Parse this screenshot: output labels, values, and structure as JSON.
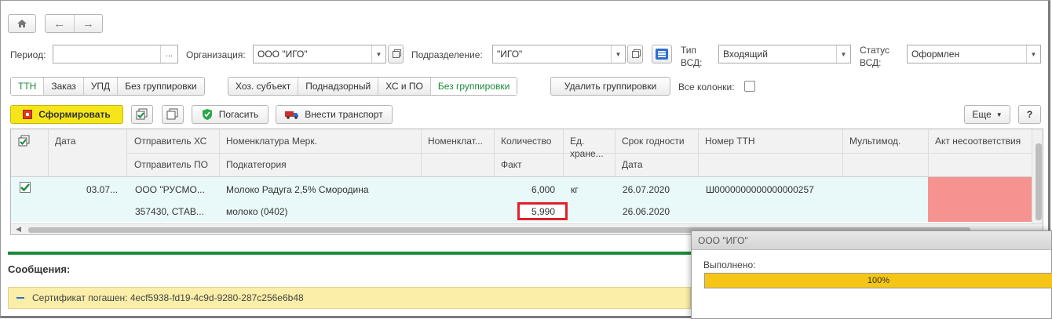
{
  "nav": {
    "home_icon": "home-icon",
    "back_icon": "arrow-left-icon",
    "forward_icon": "arrow-right-icon"
  },
  "filters": {
    "period_label": "Период:",
    "period_value": "",
    "period_btn": "...",
    "org_label": "Организация:",
    "org_value": "ООО \"ИГО\"",
    "division_label": "Подразделение:",
    "division_value": "\"ИГО\"",
    "vsd_type_label_1": "Тип",
    "vsd_type_label_2": "ВСД:",
    "vsd_type_value": "Входящий",
    "vsd_status_label_1": "Статус",
    "vsd_status_label_2": "ВСД:",
    "vsd_status_value": "Оформлен"
  },
  "grouping": {
    "group1": [
      "ТТН",
      "Заказ",
      "УПД",
      "Без группировки"
    ],
    "group1_active": 0,
    "group2": [
      "Хоз. субъект",
      "Поднадзорный",
      "ХС и ПО",
      "Без группировки"
    ],
    "group2_active": 3,
    "remove_grouping": "Удалить группировки",
    "all_columns_label": "Все колонки:"
  },
  "toolbar": {
    "form_button": "Сформировать",
    "repay_button": "Погасить",
    "transport_button": "Внести транспорт",
    "more_button": "Еще",
    "help_button": "?"
  },
  "table": {
    "headers_top": [
      "Дата",
      "Отправитель ХС",
      "Номенклатура Мерк.",
      "Номенклат...",
      "Количество",
      "Ед.",
      "Срок годности",
      "Номер ТТН",
      "Мультимод.",
      "Акт несоответствия"
    ],
    "headers_bottom": [
      "Отправитель ПО",
      "Подкатегория",
      "Факт",
      "хране...",
      "Дата"
    ],
    "row": {
      "checked": true,
      "date": "03.07...",
      "sender_hs": "ООО \"РУСМО...",
      "nomenclature": "Молоко Радуга 2,5% Смородина",
      "quantity": "6,000",
      "unit": "кг",
      "expiry": "26.07.2020",
      "ttn_number": "Ш0000000000000000257",
      "sender_po": "357430, СТАВ...",
      "subcategory": "молоко (0402)",
      "fact": "5,990",
      "date2": "26.06.2020"
    }
  },
  "messages": {
    "title": "Сообщения:",
    "text": "Сертификат погашен: 4ecf5938-fd19-4c9d-9280-287c256e6b48"
  },
  "progress": {
    "title": "ООО \"ИГО\"",
    "label": "Выполнено:",
    "value_text": "100%",
    "fraction": 1.0
  },
  "colors": {
    "accent_green": "#1a8a3a",
    "form_button": "#f5e61a",
    "act_cell": "#f4938f",
    "progress_fill": "#f5c518",
    "message_bg": "#fbeea9"
  }
}
